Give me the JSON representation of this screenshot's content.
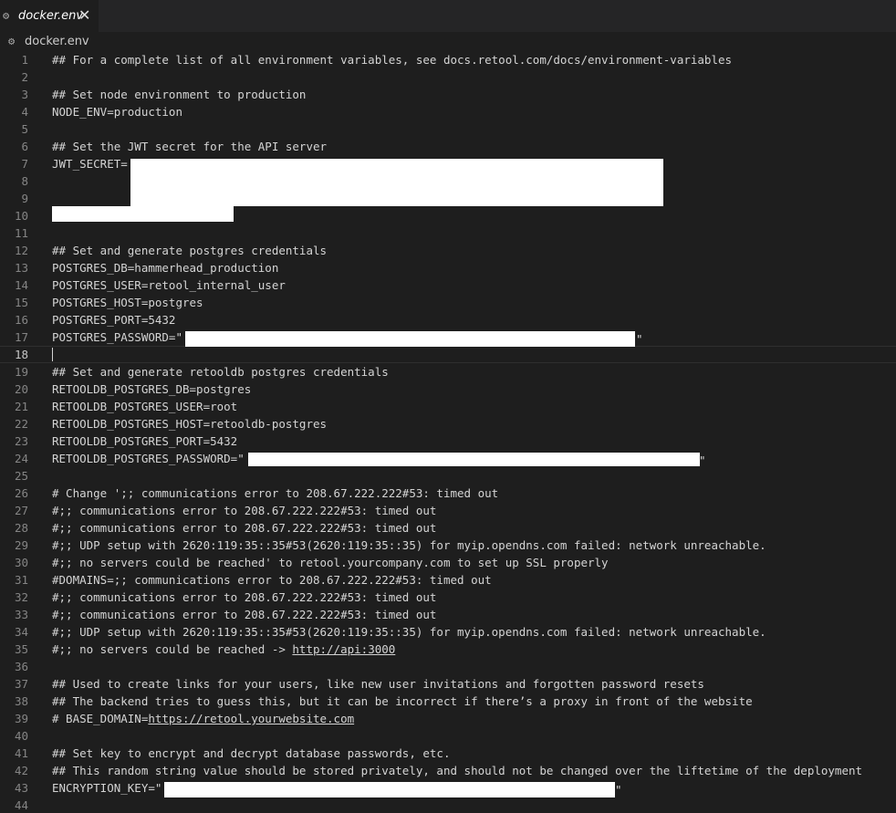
{
  "tab": {
    "icon": "gear-icon",
    "label": "docker.env",
    "close": "✕"
  },
  "breadcrumb": {
    "icon": "gear-icon",
    "label": "docker.env"
  },
  "current_line": 18,
  "lines": [
    {
      "n": "1",
      "text": "## For a complete list of all environment variables, see docs.retool.com/docs/environment-variables"
    },
    {
      "n": "2",
      "text": ""
    },
    {
      "n": "3",
      "text": "## Set node environment to production"
    },
    {
      "n": "4",
      "text": "NODE_ENV=production"
    },
    {
      "n": "5",
      "text": ""
    },
    {
      "n": "6",
      "text": "## Set the JWT secret for the API server"
    },
    {
      "n": "7",
      "text": "JWT_SECRET="
    },
    {
      "n": "8",
      "text": ""
    },
    {
      "n": "9",
      "text": ""
    },
    {
      "n": "10",
      "text": ""
    },
    {
      "n": "11",
      "text": ""
    },
    {
      "n": "12",
      "text": "## Set and generate postgres credentials"
    },
    {
      "n": "13",
      "text": "POSTGRES_DB=hammerhead_production"
    },
    {
      "n": "14",
      "text": "POSTGRES_USER=retool_internal_user"
    },
    {
      "n": "15",
      "text": "POSTGRES_HOST=postgres"
    },
    {
      "n": "16",
      "text": "POSTGRES_PORT=5432"
    },
    {
      "n": "17",
      "text": "POSTGRES_PASSWORD=\""
    },
    {
      "n": "18",
      "text": ""
    },
    {
      "n": "19",
      "text": "## Set and generate retooldb postgres credentials"
    },
    {
      "n": "20",
      "text": "RETOOLDB_POSTGRES_DB=postgres"
    },
    {
      "n": "21",
      "text": "RETOOLDB_POSTGRES_USER=root"
    },
    {
      "n": "22",
      "text": "RETOOLDB_POSTGRES_HOST=retooldb-postgres"
    },
    {
      "n": "23",
      "text": "RETOOLDB_POSTGRES_PORT=5432"
    },
    {
      "n": "24",
      "text": "RETOOLDB_POSTGRES_PASSWORD=\""
    },
    {
      "n": "25",
      "text": ""
    },
    {
      "n": "26",
      "text": "# Change ';; communications error to 208.67.222.222#53: timed out"
    },
    {
      "n": "27",
      "text": "#;; communications error to 208.67.222.222#53: timed out"
    },
    {
      "n": "28",
      "text": "#;; communications error to 208.67.222.222#53: timed out"
    },
    {
      "n": "29",
      "text": "#;; UDP setup with 2620:119:35::35#53(2620:119:35::35) for myip.opendns.com failed: network unreachable."
    },
    {
      "n": "30",
      "text": "#;; no servers could be reached' to retool.yourcompany.com to set up SSL properly"
    },
    {
      "n": "31",
      "text": "#DOMAINS=;; communications error to 208.67.222.222#53: timed out"
    },
    {
      "n": "32",
      "text": "#;; communications error to 208.67.222.222#53: timed out"
    },
    {
      "n": "33",
      "text": "#;; communications error to 208.67.222.222#53: timed out"
    },
    {
      "n": "34",
      "text": "#;; UDP setup with 2620:119:35::35#53(2620:119:35::35) for myip.opendns.com failed: network unreachable."
    },
    {
      "n": "35",
      "text": "#;; no servers could be reached -> ",
      "link": "http://api:3000"
    },
    {
      "n": "36",
      "text": ""
    },
    {
      "n": "37",
      "text": "## Used to create links for your users, like new user invitations and forgotten password resets"
    },
    {
      "n": "38",
      "text": "## The backend tries to guess this, but it can be incorrect if there’s a proxy in front of the website"
    },
    {
      "n": "39",
      "text": "# BASE_DOMAIN=",
      "link": "https://retool.yourwebsite.com"
    },
    {
      "n": "40",
      "text": ""
    },
    {
      "n": "41",
      "text": "## Set key to encrypt and decrypt database passwords, etc."
    },
    {
      "n": "42",
      "text": "## This random string value should be stored privately, and should not be changed over the liftetime of the deployment"
    },
    {
      "n": "43",
      "text": "ENCRYPTION_KEY=\""
    },
    {
      "n": "44",
      "text": ""
    }
  ],
  "closing_quotes": {
    "l17": "\"",
    "l24": "\"",
    "l43": "\""
  },
  "colors": {
    "background": "#1e1e1e",
    "tabbar": "#252526",
    "text": "#d4d4d4",
    "line_number": "#858585",
    "redaction": "#ffffff"
  }
}
